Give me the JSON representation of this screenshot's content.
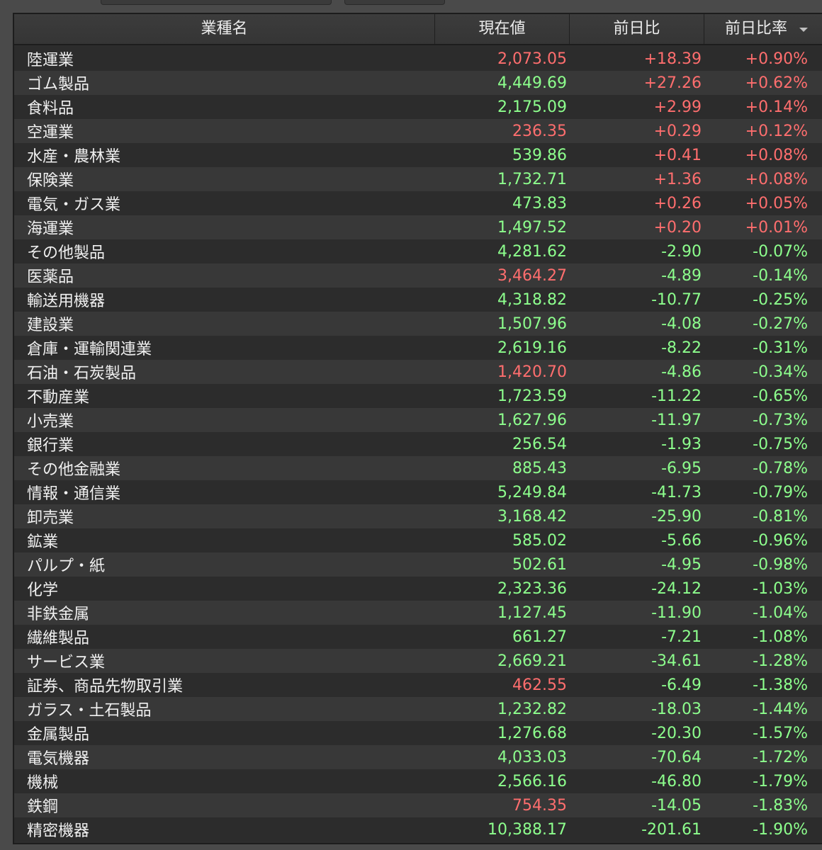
{
  "colors": {
    "up": "#ff6e6e",
    "down": "#8dff8d",
    "background": "#2d2d2d"
  },
  "header": {
    "name": "業種名",
    "price": "現在値",
    "change": "前日比",
    "change_pct": "前日比率",
    "sort_icon": "sort-descending-icon"
  },
  "rows": [
    {
      "name": "陸運業",
      "price": "2,073.05",
      "price_dir": "up",
      "change": "+18.39",
      "change_pct": "+0.90%"
    },
    {
      "name": "ゴム製品",
      "price": "4,449.69",
      "price_dir": "down",
      "change": "+27.26",
      "change_pct": "+0.62%"
    },
    {
      "name": "食料品",
      "price": "2,175.09",
      "price_dir": "down",
      "change": "+2.99",
      "change_pct": "+0.14%"
    },
    {
      "name": "空運業",
      "price": "236.35",
      "price_dir": "up",
      "change": "+0.29",
      "change_pct": "+0.12%"
    },
    {
      "name": "水産・農林業",
      "price": "539.86",
      "price_dir": "down",
      "change": "+0.41",
      "change_pct": "+0.08%"
    },
    {
      "name": "保険業",
      "price": "1,732.71",
      "price_dir": "down",
      "change": "+1.36",
      "change_pct": "+0.08%"
    },
    {
      "name": "電気・ガス業",
      "price": "473.83",
      "price_dir": "down",
      "change": "+0.26",
      "change_pct": "+0.05%"
    },
    {
      "name": "海運業",
      "price": "1,497.52",
      "price_dir": "down",
      "change": "+0.20",
      "change_pct": "+0.01%"
    },
    {
      "name": "その他製品",
      "price": "4,281.62",
      "price_dir": "down",
      "change": "-2.90",
      "change_pct": "-0.07%"
    },
    {
      "name": "医薬品",
      "price": "3,464.27",
      "price_dir": "up",
      "change": "-4.89",
      "change_pct": "-0.14%"
    },
    {
      "name": "輸送用機器",
      "price": "4,318.82",
      "price_dir": "down",
      "change": "-10.77",
      "change_pct": "-0.25%"
    },
    {
      "name": "建設業",
      "price": "1,507.96",
      "price_dir": "down",
      "change": "-4.08",
      "change_pct": "-0.27%"
    },
    {
      "name": "倉庫・運輸関連業",
      "price": "2,619.16",
      "price_dir": "down",
      "change": "-8.22",
      "change_pct": "-0.31%"
    },
    {
      "name": "石油・石炭製品",
      "price": "1,420.70",
      "price_dir": "up",
      "change": "-4.86",
      "change_pct": "-0.34%"
    },
    {
      "name": "不動産業",
      "price": "1,723.59",
      "price_dir": "down",
      "change": "-11.22",
      "change_pct": "-0.65%"
    },
    {
      "name": "小売業",
      "price": "1,627.96",
      "price_dir": "down",
      "change": "-11.97",
      "change_pct": "-0.73%"
    },
    {
      "name": "銀行業",
      "price": "256.54",
      "price_dir": "down",
      "change": "-1.93",
      "change_pct": "-0.75%"
    },
    {
      "name": "その他金融業",
      "price": "885.43",
      "price_dir": "down",
      "change": "-6.95",
      "change_pct": "-0.78%"
    },
    {
      "name": "情報・通信業",
      "price": "5,249.84",
      "price_dir": "down",
      "change": "-41.73",
      "change_pct": "-0.79%"
    },
    {
      "name": "卸売業",
      "price": "3,168.42",
      "price_dir": "down",
      "change": "-25.90",
      "change_pct": "-0.81%"
    },
    {
      "name": "鉱業",
      "price": "585.02",
      "price_dir": "down",
      "change": "-5.66",
      "change_pct": "-0.96%"
    },
    {
      "name": "パルプ・紙",
      "price": "502.61",
      "price_dir": "down",
      "change": "-4.95",
      "change_pct": "-0.98%"
    },
    {
      "name": "化学",
      "price": "2,323.36",
      "price_dir": "down",
      "change": "-24.12",
      "change_pct": "-1.03%"
    },
    {
      "name": "非鉄金属",
      "price": "1,127.45",
      "price_dir": "down",
      "change": "-11.90",
      "change_pct": "-1.04%"
    },
    {
      "name": "繊維製品",
      "price": "661.27",
      "price_dir": "down",
      "change": "-7.21",
      "change_pct": "-1.08%"
    },
    {
      "name": "サービス業",
      "price": "2,669.21",
      "price_dir": "down",
      "change": "-34.61",
      "change_pct": "-1.28%"
    },
    {
      "name": "証券、商品先物取引業",
      "price": "462.55",
      "price_dir": "up",
      "change": "-6.49",
      "change_pct": "-1.38%"
    },
    {
      "name": "ガラス・土石製品",
      "price": "1,232.82",
      "price_dir": "down",
      "change": "-18.03",
      "change_pct": "-1.44%"
    },
    {
      "name": "金属製品",
      "price": "1,276.68",
      "price_dir": "down",
      "change": "-20.30",
      "change_pct": "-1.57%"
    },
    {
      "name": "電気機器",
      "price": "4,033.03",
      "price_dir": "down",
      "change": "-70.64",
      "change_pct": "-1.72%"
    },
    {
      "name": "機械",
      "price": "2,566.16",
      "price_dir": "down",
      "change": "-46.80",
      "change_pct": "-1.79%"
    },
    {
      "name": "鉄鋼",
      "price": "754.35",
      "price_dir": "up",
      "change": "-14.05",
      "change_pct": "-1.83%"
    },
    {
      "name": "精密機器",
      "price": "10,388.17",
      "price_dir": "down",
      "change": "-201.61",
      "change_pct": "-1.90%"
    }
  ]
}
